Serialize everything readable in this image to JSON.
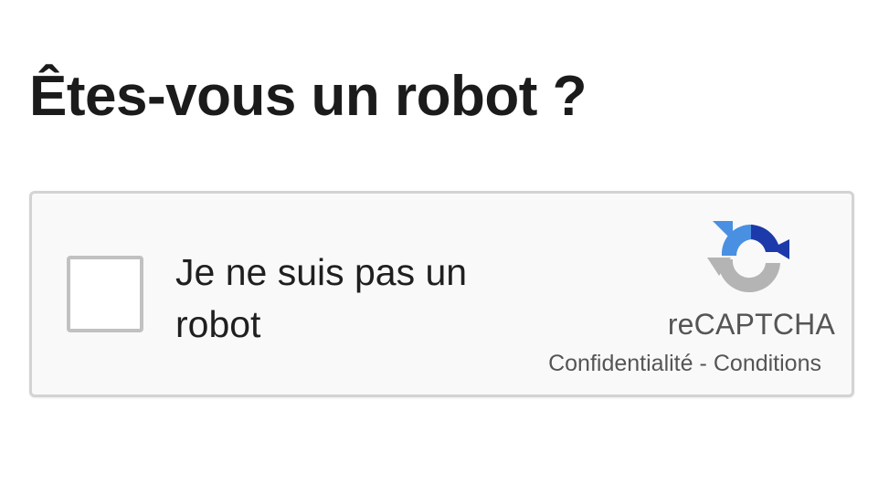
{
  "page": {
    "title": "Êtes-vous un robot ?"
  },
  "captcha": {
    "checkbox_label": "Je ne suis pas un robot",
    "checked": false,
    "brand": "reCAPTCHA",
    "privacy_link": "Confidentialité",
    "separator": "-",
    "terms_link": "Conditions",
    "logo_icon": "recaptcha-logo-icon"
  },
  "colors": {
    "logo_dark_blue": "#1c3aa9",
    "logo_light_blue": "#4a90e2",
    "logo_gray": "#b4b4b4",
    "box_background": "#f9f9f9",
    "box_border": "#d3d3d3"
  }
}
